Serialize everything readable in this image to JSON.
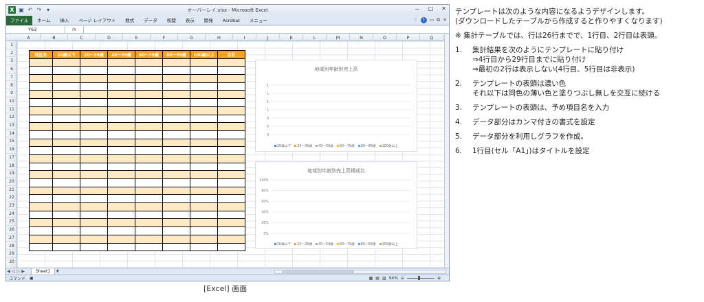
{
  "window": {
    "title": "オーバーレイ.xlsx - Microsoft Excel",
    "controls": [
      "－",
      "□",
      "✕"
    ]
  },
  "ribbon": {
    "tabs": [
      "ファイル",
      "ホーム",
      "挿入",
      "ページ レイアウト",
      "数式",
      "データ",
      "校閲",
      "表示",
      "開発",
      "Acrobat",
      "メニュー"
    ]
  },
  "formula_bar": {
    "name_box": "Y63",
    "fx": "fx",
    "value": ""
  },
  "grid": {
    "columns": [
      "A",
      "B",
      "C",
      "D",
      "E",
      "F",
      "G",
      "H",
      "I",
      "J",
      "K",
      "L",
      "M",
      "N",
      "O",
      "P",
      "Q"
    ],
    "rows": [
      "1",
      "2",
      "3",
      "6",
      "7",
      "8",
      "9",
      "10",
      "11",
      "12",
      "13",
      "14",
      "15",
      "16",
      "17",
      "18",
      "19",
      "20",
      "21",
      "22",
      "23",
      "24",
      "25",
      "26",
      "27",
      "28",
      "29",
      "30"
    ]
  },
  "table": {
    "headers": [
      "地区名",
      "20歳以下",
      "20～39歳",
      "40～59歳",
      "60～79歳",
      "80～99歳",
      "100歳以上",
      "合計"
    ],
    "header_color": "#f7a21b",
    "stripe_color": "#fde9c4",
    "data_rows": 24
  },
  "chart1": {
    "title": "地域別年齢別売上高",
    "y_ticks": [
      "1",
      "1",
      "1",
      "1",
      "0",
      "0",
      "0"
    ],
    "legend": [
      "20歳以下",
      "20～39歳",
      "40～59歳",
      "60～79歳",
      "80～99歳",
      "100歳以上"
    ]
  },
  "chart2": {
    "title": "地域別年齢別売上高構成比",
    "y_ticks": [
      "100%",
      "80%",
      "60%",
      "40%",
      "20%",
      "0%"
    ],
    "legend": [
      "20歳以下",
      "20～39歳",
      "40～59歳",
      "60～79歳",
      "80～99歳",
      "100歳以上"
    ]
  },
  "legend_colors": [
    "#4f81bd",
    "#f79646",
    "#a5a5a5",
    "#ffc000",
    "#4bacc6",
    "#9bbb59"
  ],
  "sheet": {
    "tab": "Sheet1",
    "mode": "コマンド",
    "zoom": "94%"
  },
  "caption": "[Excel] 画面",
  "notes": {
    "intro1": "テンプレートは次のような内容になるようデザインします。",
    "intro2": "(ダウンロードしたテーブルから作成すると作りやすくなります)",
    "note": "※ 集計テーブルでは、行は26行までで、1行目、2行目は表頭。",
    "steps": [
      {
        "num": "1.",
        "lines": [
          "集計結果を次のようにテンプレートに貼り付け",
          "⇒4行目から29行目までに貼り付け",
          "⇒最初の2行は表示しない(4行目、5行目は非表示)"
        ]
      },
      {
        "num": "2.",
        "lines": [
          "テンプレートの表頭は濃い色",
          "それ以下は同色の薄い色と塗りつぶし無しを交互に続ける"
        ]
      },
      {
        "num": "3.",
        "lines": [
          "テンプレートの表頭は、予め項目名を入力"
        ]
      },
      {
        "num": "4.",
        "lines": [
          "データ部分はカンマ付きの書式を設定"
        ]
      },
      {
        "num": "5.",
        "lines": [
          "データ部分を利用しグラフを作成。"
        ]
      },
      {
        "num": "6.",
        "lines": [
          "1行目(セル「A1」)はタイトルを設定"
        ]
      }
    ]
  }
}
